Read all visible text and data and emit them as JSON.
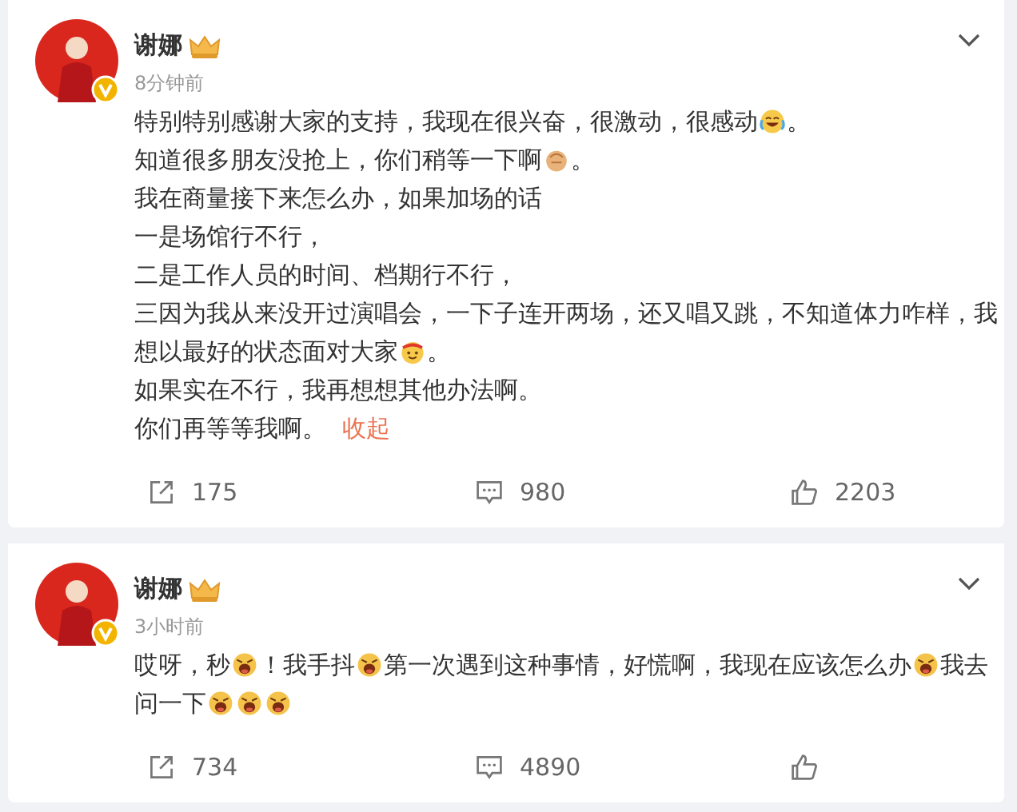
{
  "posts": [
    {
      "author": "谢娜",
      "time": "8分钟前",
      "paragraphs": [
        [
          {
            "kind": "text",
            "text": "特别特别感谢大家的支持，我现在很兴奋，很激动，很感动"
          },
          {
            "kind": "laugh-cry"
          },
          {
            "kind": "text",
            "text": "。"
          }
        ],
        [
          {
            "kind": "text",
            "text": "知道很多朋友没抢上，你们稍等一下啊"
          },
          {
            "kind": "bun"
          },
          {
            "kind": "text",
            "text": "。"
          }
        ],
        [
          {
            "kind": "text",
            "text": "我在商量接下来怎么办，如果加场的话"
          }
        ],
        [
          {
            "kind": "text",
            "text": "一是场馆行不行，"
          }
        ],
        [
          {
            "kind": "text",
            "text": "二是工作人员的时间、档期行不行，"
          }
        ],
        [
          {
            "kind": "text",
            "text": "三因为我从来没开过演唱会，一下子连开两场，还又唱又跳，不知道体力咋样，我"
          }
        ],
        [
          {
            "kind": "text",
            "text": "想以最好的状态面对大家"
          },
          {
            "kind": "party"
          },
          {
            "kind": "text",
            "text": "。"
          }
        ],
        [
          {
            "kind": "text",
            "text": "如果实在不行，我再想想其他办法啊。"
          }
        ],
        [
          {
            "kind": "text",
            "text": "你们再等等我啊。"
          },
          {
            "kind": "link",
            "text": "收起"
          }
        ]
      ],
      "actions": {
        "reposts": "175",
        "comments": "980",
        "likes": "2203"
      }
    },
    {
      "author": "谢娜",
      "time": "3小时前",
      "paragraphs": [
        [
          {
            "kind": "text",
            "text": "哎呀，秒"
          },
          {
            "kind": "shout"
          },
          {
            "kind": "text",
            "text": "！我手抖"
          },
          {
            "kind": "shout"
          },
          {
            "kind": "text",
            "text": "第一次遇到这种事情，好慌啊，我现在应该怎么办"
          },
          {
            "kind": "shout"
          },
          {
            "kind": "text",
            "text": "我去"
          }
        ],
        [
          {
            "kind": "text",
            "text": "问一下"
          },
          {
            "kind": "shout"
          },
          {
            "kind": "shout"
          },
          {
            "kind": "shout"
          }
        ]
      ],
      "actions": {
        "reposts": "734",
        "comments": "4890"
      }
    }
  ]
}
